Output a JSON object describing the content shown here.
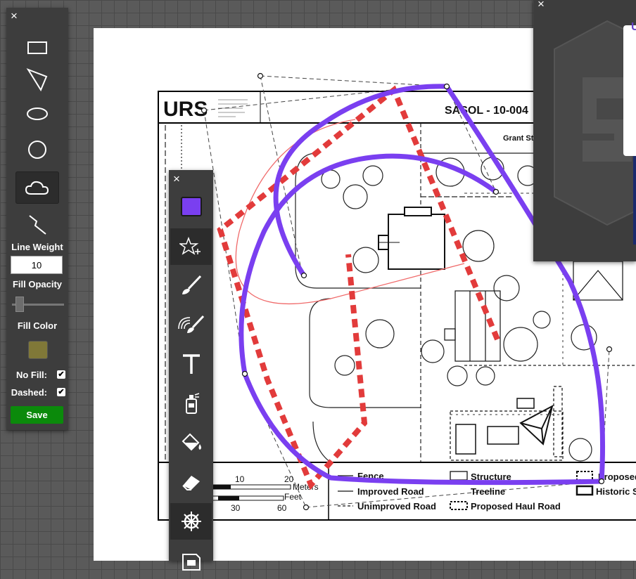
{
  "shape_panel": {
    "close": "×",
    "shapes": [
      {
        "name": "rectangle",
        "icon": "rectangle-icon",
        "active": false
      },
      {
        "name": "triangle",
        "icon": "triangle-icon",
        "active": false
      },
      {
        "name": "ellipse",
        "icon": "ellipse-icon",
        "active": false
      },
      {
        "name": "circle",
        "icon": "circle-icon",
        "active": false
      },
      {
        "name": "cloud",
        "icon": "cloud-icon",
        "active": true
      },
      {
        "name": "polyline",
        "icon": "polyline-icon",
        "active": false
      }
    ],
    "line_weight_label": "Line Weight",
    "line_weight_value": "10",
    "fill_opacity_label": "Fill Opacity",
    "fill_opacity_value": 0.15,
    "fill_color_label": "Fill Color",
    "fill_color": "#807838",
    "no_fill_label": "No Fill:",
    "no_fill_checked": true,
    "dashed_label": "Dashed:",
    "dashed_checked": true,
    "save_label": "Save",
    "checkmark": "✔"
  },
  "tool_panel": {
    "close": "×",
    "stroke_color": "#7a3ff0",
    "tools": [
      "color-picker",
      "shape-stamp",
      "brush",
      "highlighter-brush",
      "text",
      "spray",
      "fill-bucket",
      "eraser",
      "pan-wheel",
      "save-disk"
    ]
  },
  "map": {
    "logo": "URS",
    "title": "SASOL - 10-004",
    "street": "Grant St",
    "scale_top": [
      "10",
      "20"
    ],
    "scale_bottom": [
      "30",
      "60"
    ],
    "meters_label": "Meters",
    "feet_label": "Feet",
    "legend": {
      "fence": "Fence",
      "improved_road": "Improved Road",
      "unimproved_road": "Unimproved Road",
      "structure": "Structure",
      "treeline": "Treeline",
      "proposed_haul_road": "Proposed Haul Road",
      "proposed": "Proposed",
      "historic": "Historic S"
    }
  },
  "right_panel": {
    "close": "×",
    "card_text": "U"
  },
  "annotations": {
    "purple_color": "#7a3ff0",
    "red_color": "#e23b3b",
    "thin_red_color": "#f06a6a"
  }
}
